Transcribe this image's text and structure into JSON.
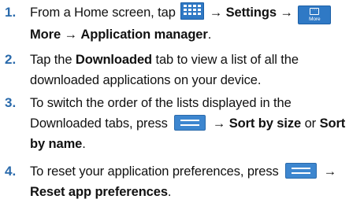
{
  "steps": [
    {
      "num": "1.",
      "parts": {
        "a": "From a Home screen, tap",
        "arrow1": "→",
        "settings": "Settings",
        "arrow2": "→",
        "more_icon_label": "More",
        "more": "More",
        "arrow3": "→",
        "app_manager": "Application manager",
        "end": "."
      }
    },
    {
      "num": "2.",
      "parts": {
        "a": "Tap the",
        "downloaded": "Downloaded",
        "b": "tab to view a list of all the",
        "c": "downloaded applications on your device."
      }
    },
    {
      "num": "3.",
      "parts": {
        "a": "To switch the order of the lists displayed in the",
        "b": "Downloaded tabs, press",
        "arrow": "→",
        "sort_size": "Sort by size",
        "or": "or",
        "sort": "Sort",
        "by_name": "by name",
        "end": "."
      }
    },
    {
      "num": "4.",
      "parts": {
        "a": "To reset your application preferences, press",
        "arrow": "→",
        "reset": "Reset app preferences",
        "end": "."
      }
    }
  ],
  "colors": {
    "step_number": "#2a6aab",
    "icon_blue": "#2f79c5"
  },
  "icons": {
    "apps": "apps-grid-icon",
    "more": "more-icon",
    "menu": "menu-key-icon"
  }
}
